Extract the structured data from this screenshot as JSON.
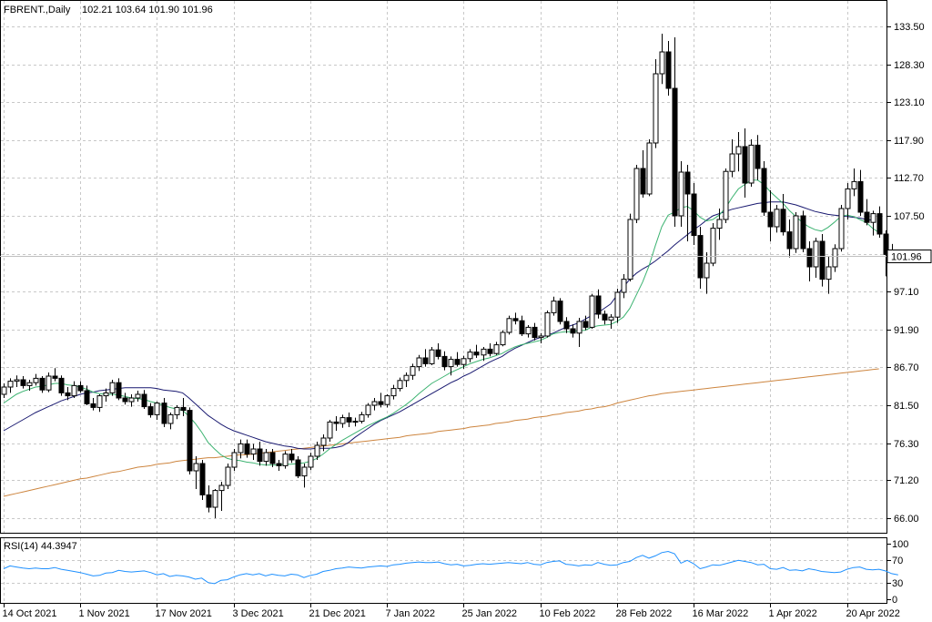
{
  "header": {
    "symbol_line": "FBRENT.,Daily",
    "ohlc_line": "102.21 103.64 101.90 101.96"
  },
  "rsi_header": {
    "label": "RSI(14) 44.3947"
  },
  "colors": {
    "background": "#ffffff",
    "grid": "#c8c8c8",
    "candle": "#000000",
    "ma_fast": "#3cb371",
    "ma_mid": "#191970",
    "ma_slow": "#cd853f",
    "rsi": "#1e90ff"
  },
  "chart_data": {
    "type": "candlestick",
    "title": "FBRENT.,Daily",
    "price_axis": {
      "ticks": [
        "133.50",
        "128.30",
        "123.10",
        "117.90",
        "112.70",
        "107.50",
        "102.30",
        "97.10",
        "91.90",
        "86.70",
        "81.50",
        "76.30",
        "71.20",
        "66.00"
      ],
      "current_price_label": "101.96",
      "current_price": 101.96,
      "range": [
        64.0,
        137.0
      ]
    },
    "date_axis": {
      "labels": [
        "14 Oct 2021",
        "1 Nov 2021",
        "17 Nov 2021",
        "3 Dec 2021",
        "21 Dec 2021",
        "7 Jan 2022",
        "25 Jan 2022",
        "10 Feb 2022",
        "28 Feb 2022",
        "16 Mar 2022",
        "1 Apr 2022",
        "20 Apr 2022"
      ],
      "label_bar_index": [
        0,
        12,
        24,
        36,
        48,
        60,
        72,
        84,
        96,
        108,
        120,
        132
      ]
    },
    "grid": true,
    "candles": [
      [
        83.0,
        84.5,
        82.5,
        84.0
      ],
      [
        84.0,
        85.2,
        83.2,
        84.8
      ],
      [
        84.8,
        85.6,
        84.0,
        85.0
      ],
      [
        85.0,
        85.5,
        83.8,
        84.2
      ],
      [
        84.2,
        85.0,
        83.5,
        84.6
      ],
      [
        84.6,
        85.8,
        84.2,
        85.2
      ],
      [
        85.2,
        85.5,
        83.2,
        83.6
      ],
      [
        83.6,
        86.0,
        83.3,
        85.5
      ],
      [
        85.5,
        86.6,
        84.8,
        85.2
      ],
      [
        85.2,
        85.6,
        82.8,
        83.2
      ],
      [
        83.2,
        84.0,
        82.2,
        82.8
      ],
      [
        82.8,
        84.8,
        82.5,
        84.2
      ],
      [
        84.2,
        84.8,
        83.2,
        83.5
      ],
      [
        83.5,
        84.2,
        81.5,
        81.7
      ],
      [
        81.7,
        82.5,
        80.8,
        81.2
      ],
      [
        81.2,
        83.0,
        80.6,
        82.8
      ],
      [
        82.8,
        83.8,
        82.0,
        83.2
      ],
      [
        83.2,
        85.0,
        82.8,
        84.6
      ],
      [
        84.6,
        85.2,
        82.2,
        82.5
      ],
      [
        82.5,
        83.2,
        81.6,
        82.0
      ],
      [
        82.0,
        83.0,
        81.3,
        82.5
      ],
      [
        82.5,
        83.5,
        82.0,
        83.0
      ],
      [
        83.0,
        83.6,
        81.0,
        81.3
      ],
      [
        81.3,
        81.8,
        79.8,
        80.2
      ],
      [
        80.2,
        82.0,
        79.5,
        81.8
      ],
      [
        81.8,
        82.5,
        78.5,
        79.0
      ],
      [
        79.0,
        80.5,
        78.2,
        80.2
      ],
      [
        80.2,
        81.5,
        79.6,
        81.2
      ],
      [
        81.2,
        82.5,
        80.0,
        80.8
      ],
      [
        80.8,
        81.2,
        72.0,
        72.5
      ],
      [
        72.5,
        74.5,
        70.0,
        73.5
      ],
      [
        73.5,
        74.0,
        68.5,
        69.2
      ],
      [
        69.2,
        70.5,
        66.8,
        67.5
      ],
      [
        67.5,
        70.0,
        66.0,
        69.8
      ],
      [
        69.8,
        71.0,
        67.0,
        70.5
      ],
      [
        70.5,
        73.5,
        70.0,
        73.0
      ],
      [
        73.0,
        75.5,
        72.5,
        75.0
      ],
      [
        75.0,
        76.8,
        74.2,
        76.2
      ],
      [
        76.2,
        76.8,
        74.3,
        74.8
      ],
      [
        74.8,
        76.2,
        74.0,
        75.5
      ],
      [
        75.5,
        76.5,
        73.2,
        73.8
      ],
      [
        73.8,
        75.5,
        73.2,
        75.0
      ],
      [
        75.0,
        75.5,
        73.0,
        73.5
      ],
      [
        73.5,
        74.0,
        72.5,
        73.2
      ],
      [
        73.2,
        75.2,
        72.8,
        74.8
      ],
      [
        74.8,
        75.5,
        73.6,
        74.0
      ],
      [
        74.0,
        74.5,
        71.5,
        71.8
      ],
      [
        71.8,
        73.5,
        70.2,
        73.0
      ],
      [
        73.0,
        75.0,
        72.6,
        74.5
      ],
      [
        74.5,
        76.5,
        74.0,
        76.0
      ],
      [
        76.0,
        77.5,
        75.2,
        77.0
      ],
      [
        77.0,
        79.5,
        76.5,
        79.2
      ],
      [
        79.2,
        80.0,
        78.0,
        79.0
      ],
      [
        79.0,
        80.2,
        78.4,
        79.8
      ],
      [
        79.8,
        80.5,
        78.5,
        79.2
      ],
      [
        79.2,
        79.8,
        78.6,
        79.3
      ],
      [
        79.3,
        80.6,
        79.0,
        80.2
      ],
      [
        80.2,
        81.8,
        79.8,
        81.5
      ],
      [
        81.5,
        82.5,
        80.8,
        82.0
      ],
      [
        82.0,
        83.2,
        81.2,
        81.6
      ],
      [
        81.6,
        83.0,
        81.2,
        82.8
      ],
      [
        82.8,
        84.3,
        82.3,
        83.8
      ],
      [
        83.8,
        85.3,
        83.4,
        84.9
      ],
      [
        84.9,
        86.0,
        84.0,
        85.6
      ],
      [
        85.6,
        87.2,
        85.0,
        86.8
      ],
      [
        86.8,
        88.4,
        86.2,
        88.0
      ],
      [
        88.0,
        89.2,
        86.8,
        87.2
      ],
      [
        87.2,
        89.5,
        87.0,
        89.1
      ],
      [
        89.1,
        90.0,
        87.8,
        88.2
      ],
      [
        88.2,
        88.9,
        86.3,
        86.8
      ],
      [
        86.8,
        88.2,
        85.6,
        87.8
      ],
      [
        87.8,
        88.8,
        86.8,
        87.1
      ],
      [
        87.1,
        88.3,
        86.5,
        87.9
      ],
      [
        87.9,
        89.2,
        87.4,
        88.8
      ],
      [
        88.8,
        89.8,
        88.0,
        88.4
      ],
      [
        88.4,
        89.5,
        87.6,
        89.2
      ],
      [
        89.2,
        90.0,
        88.2,
        88.6
      ],
      [
        88.6,
        90.2,
        88.4,
        89.8
      ],
      [
        89.8,
        91.8,
        89.6,
        91.5
      ],
      [
        91.5,
        93.8,
        91.2,
        93.4
      ],
      [
        93.4,
        94.2,
        92.6,
        93.1
      ],
      [
        93.1,
        93.8,
        91.0,
        91.3
      ],
      [
        91.3,
        92.5,
        90.8,
        92.2
      ],
      [
        92.2,
        92.8,
        90.4,
        90.8
      ],
      [
        90.8,
        91.4,
        90.0,
        91.0
      ],
      [
        91.0,
        94.5,
        90.8,
        94.2
      ],
      [
        94.2,
        96.4,
        93.8,
        95.8
      ],
      [
        95.8,
        96.2,
        92.6,
        93.0
      ],
      [
        93.0,
        93.6,
        91.4,
        92.0
      ],
      [
        92.0,
        92.6,
        90.8,
        91.4
      ],
      [
        91.4,
        93.5,
        89.5,
        93.0
      ],
      [
        93.0,
        93.8,
        91.8,
        92.2
      ],
      [
        92.2,
        96.8,
        92.0,
        96.5
      ],
      [
        96.5,
        97.4,
        93.4,
        94.0
      ],
      [
        94.0,
        94.5,
        92.6,
        93.2
      ],
      [
        93.2,
        94.0,
        92.0,
        93.6
      ],
      [
        93.6,
        97.5,
        92.8,
        97.0
      ],
      [
        97.0,
        99.5,
        96.2,
        98.8
      ],
      [
        98.8,
        107.8,
        98.5,
        107.0
      ],
      [
        107.0,
        114.5,
        106.5,
        114.0
      ],
      [
        114.0,
        116.5,
        110.0,
        110.5
      ],
      [
        110.5,
        118.0,
        110.2,
        117.5
      ],
      [
        117.5,
        129.0,
        116.8,
        127.0
      ],
      [
        127.0,
        132.5,
        125.6,
        130.0
      ],
      [
        130.0,
        131.5,
        124.0,
        125.0
      ],
      [
        125.0,
        132.0,
        106.0,
        107.5
      ],
      [
        107.5,
        115.0,
        106.0,
        113.5
      ],
      [
        113.5,
        114.5,
        104.0,
        110.5
      ],
      [
        110.5,
        112.0,
        103.5,
        104.8
      ],
      [
        104.8,
        106.0,
        97.5,
        99.0
      ],
      [
        99.0,
        102.5,
        96.8,
        101.0
      ],
      [
        101.0,
        106.5,
        100.6,
        105.8
      ],
      [
        105.8,
        108.5,
        104.2,
        107.0
      ],
      [
        107.0,
        114.0,
        106.5,
        113.6
      ],
      [
        113.6,
        118.0,
        112.8,
        116.0
      ],
      [
        116.0,
        119.0,
        113.6,
        117.0
      ],
      [
        117.0,
        119.5,
        110.0,
        112.0
      ],
      [
        112.0,
        118.0,
        111.5,
        117.2
      ],
      [
        117.2,
        118.6,
        112.4,
        114.0
      ],
      [
        114.0,
        115.0,
        107.5,
        108.0
      ],
      [
        108.0,
        111.0,
        104.0,
        106.0
      ],
      [
        106.0,
        109.0,
        105.2,
        108.4
      ],
      [
        108.4,
        110.5,
        104.8,
        105.3
      ],
      [
        105.3,
        107.0,
        101.8,
        103.0
      ],
      [
        103.0,
        108.0,
        102.4,
        107.5
      ],
      [
        107.5,
        108.2,
        102.5,
        103.0
      ],
      [
        103.0,
        104.0,
        98.5,
        100.5
      ],
      [
        100.5,
        104.5,
        99.0,
        104.0
      ],
      [
        104.0,
        105.0,
        97.8,
        98.8
      ],
      [
        98.8,
        102.0,
        96.8,
        100.5
      ],
      [
        100.5,
        103.6,
        99.8,
        103.0
      ],
      [
        103.0,
        109.0,
        102.6,
        108.5
      ],
      [
        108.5,
        112.0,
        107.0,
        111.2
      ],
      [
        111.2,
        114.0,
        110.2,
        112.2
      ],
      [
        112.2,
        113.8,
        107.5,
        108.0
      ],
      [
        108.0,
        109.8,
        106.2,
        106.6
      ],
      [
        106.6,
        108.2,
        104.8,
        107.8
      ],
      [
        107.8,
        108.8,
        104.5,
        105.0
      ],
      [
        105.0,
        105.5,
        99.2,
        102.2
      ],
      [
        102.21,
        103.64,
        101.9,
        101.96
      ]
    ],
    "indicators": {
      "ma_fast": [
        81.8,
        82.4,
        83.0,
        83.4,
        83.7,
        84.0,
        84.1,
        84.3,
        84.5,
        84.5,
        84.3,
        84.2,
        84.0,
        83.7,
        83.3,
        83.1,
        83.0,
        83.0,
        82.9,
        82.7,
        82.5,
        82.4,
        82.3,
        82.0,
        81.8,
        81.5,
        81.2,
        81.0,
        80.8,
        80.0,
        79.0,
        77.8,
        76.4,
        75.5,
        74.7,
        74.2,
        74.0,
        73.9,
        73.7,
        73.6,
        73.4,
        73.3,
        73.3,
        73.3,
        73.4,
        73.4,
        73.5,
        73.6,
        73.8,
        74.2,
        74.8,
        75.5,
        76.1,
        76.7,
        77.2,
        77.7,
        78.2,
        78.7,
        79.1,
        79.5,
        79.9,
        80.4,
        81.0,
        81.6,
        82.3,
        83.1,
        83.8,
        84.5,
        85.0,
        85.5,
        86.0,
        86.4,
        86.8,
        87.2,
        87.5,
        87.8,
        88.0,
        88.3,
        88.6,
        89.1,
        89.5,
        89.8,
        90.0,
        90.2,
        90.4,
        90.8,
        91.3,
        91.5,
        91.6,
        91.6,
        91.7,
        91.8,
        92.2,
        92.4,
        92.5,
        92.6,
        93.0,
        93.6,
        94.8,
        96.6,
        98.4,
        100.6,
        103.4,
        106.0,
        107.6,
        108.0,
        108.6,
        108.8,
        108.2,
        107.3,
        106.8,
        107.0,
        107.6,
        108.6,
        110.0,
        111.2,
        111.8,
        112.4,
        112.4,
        111.8,
        110.8,
        110.0,
        109.2,
        108.2,
        107.4,
        106.6,
        106.0,
        105.6,
        105.4,
        105.9,
        106.6,
        107.4,
        107.6,
        107.4,
        107.0,
        106.6,
        105.8,
        105.2
      ],
      "ma_mid": [
        78.0,
        78.5,
        79.0,
        79.5,
        80.0,
        80.5,
        80.9,
        81.3,
        81.7,
        82.1,
        82.4,
        82.7,
        83.0,
        83.2,
        83.3,
        83.5,
        83.6,
        83.7,
        83.8,
        83.9,
        83.9,
        83.9,
        83.9,
        83.9,
        83.8,
        83.6,
        83.5,
        83.4,
        83.2,
        82.5,
        81.7,
        80.9,
        80.1,
        79.5,
        78.9,
        78.4,
        78.0,
        77.7,
        77.4,
        77.1,
        76.8,
        76.5,
        76.3,
        76.1,
        75.9,
        75.8,
        75.6,
        75.5,
        75.5,
        75.6,
        75.6,
        75.6,
        75.7,
        75.9,
        76.4,
        77.1,
        77.7,
        78.3,
        78.9,
        79.4,
        79.8,
        80.2,
        80.6,
        81.1,
        81.6,
        82.1,
        82.6,
        83.1,
        83.6,
        84.1,
        84.6,
        85.0,
        85.5,
        85.9,
        86.4,
        86.9,
        87.4,
        87.8,
        88.2,
        88.8,
        89.3,
        89.7,
        90.1,
        90.5,
        90.8,
        91.1,
        91.4,
        91.8,
        92.2,
        92.5,
        92.8,
        93.3,
        93.8,
        94.2,
        94.8,
        95.4,
        96.6,
        97.7,
        98.8,
        99.6,
        100.2,
        100.7,
        101.3,
        102.0,
        102.7,
        103.5,
        104.2,
        104.9,
        105.6,
        106.2,
        106.9,
        107.5,
        107.8,
        108.1,
        108.4,
        108.6,
        108.8,
        109.0,
        109.2,
        109.3,
        109.4,
        109.4,
        109.4,
        109.2,
        109.0,
        108.7,
        108.4,
        108.1,
        107.9,
        107.7,
        107.6,
        107.5,
        107.4,
        107.3,
        107.2,
        107.0,
        106.9
      ],
      "ma_slow": [
        69.0,
        69.2,
        69.4,
        69.6,
        69.8,
        70.0,
        70.2,
        70.4,
        70.6,
        70.8,
        71.0,
        71.2,
        71.4,
        71.5,
        71.7,
        71.9,
        72.1,
        72.3,
        72.4,
        72.6,
        72.8,
        73.0,
        73.1,
        73.2,
        73.4,
        73.5,
        73.6,
        73.8,
        73.9,
        74.0,
        74.1,
        74.2,
        74.3,
        74.3,
        74.4,
        74.5,
        74.6,
        74.7,
        74.7,
        74.8,
        74.9,
        75.0,
        75.1,
        75.2,
        75.3,
        75.4,
        75.5,
        75.6,
        75.7,
        75.8,
        75.9,
        76.0,
        76.1,
        76.2,
        76.3,
        76.4,
        76.5,
        76.6,
        76.7,
        76.8,
        76.9,
        77.0,
        77.1,
        77.3,
        77.4,
        77.5,
        77.6,
        77.7,
        77.9,
        78.0,
        78.1,
        78.2,
        78.3,
        78.5,
        78.6,
        78.7,
        78.8,
        79.0,
        79.1,
        79.2,
        79.4,
        79.5,
        79.6,
        79.8,
        79.9,
        80.0,
        80.2,
        80.3,
        80.5,
        80.6,
        80.7,
        80.9,
        81.0,
        81.2,
        81.3,
        81.5,
        81.8,
        82.0,
        82.2,
        82.4,
        82.6,
        82.8,
        82.9,
        83.1,
        83.2,
        83.3,
        83.4,
        83.5,
        83.6,
        83.7,
        83.8,
        83.9,
        84.0,
        84.1,
        84.2,
        84.3,
        84.4,
        84.5,
        84.6,
        84.7,
        84.8,
        84.9,
        85.0,
        85.1,
        85.2,
        85.3,
        85.4,
        85.5,
        85.6,
        85.7,
        85.8,
        85.9,
        86.0,
        86.1,
        86.2,
        86.3,
        86.4,
        86.5
      ]
    },
    "rsi": {
      "title": "RSI(14) 44.3947",
      "range": [
        0,
        100
      ],
      "ticks": [
        "100",
        "70",
        "30",
        "0"
      ],
      "values": [
        55,
        60,
        58,
        56,
        55,
        56,
        55,
        55,
        57,
        54,
        52,
        50,
        48,
        45,
        42,
        43,
        47,
        48,
        52,
        50,
        49,
        50,
        51,
        48,
        44,
        46,
        41,
        43,
        42,
        40,
        36,
        38,
        30,
        28,
        34,
        35,
        40,
        44,
        46,
        44,
        46,
        42,
        45,
        43,
        42,
        45,
        44,
        39,
        43,
        45,
        50,
        52,
        55,
        56,
        58,
        57,
        56,
        58,
        59,
        60,
        59,
        62,
        63,
        65,
        66,
        67,
        66,
        66,
        67,
        64,
        62,
        63,
        60,
        61,
        63,
        64,
        63,
        64,
        65,
        66,
        65,
        64,
        66,
        63,
        62,
        66,
        68,
        69,
        63,
        62,
        60,
        62,
        61,
        66,
        63,
        61,
        62,
        66,
        68,
        75,
        79,
        74,
        78,
        84,
        86,
        82,
        65,
        70,
        64,
        55,
        58,
        62,
        61,
        64,
        67,
        70,
        68,
        66,
        62,
        63,
        55,
        54,
        57,
        52,
        53,
        51,
        55,
        53,
        50,
        49,
        48,
        49,
        54,
        57,
        58,
        54,
        53,
        54,
        51,
        46,
        44
      ]
    }
  }
}
